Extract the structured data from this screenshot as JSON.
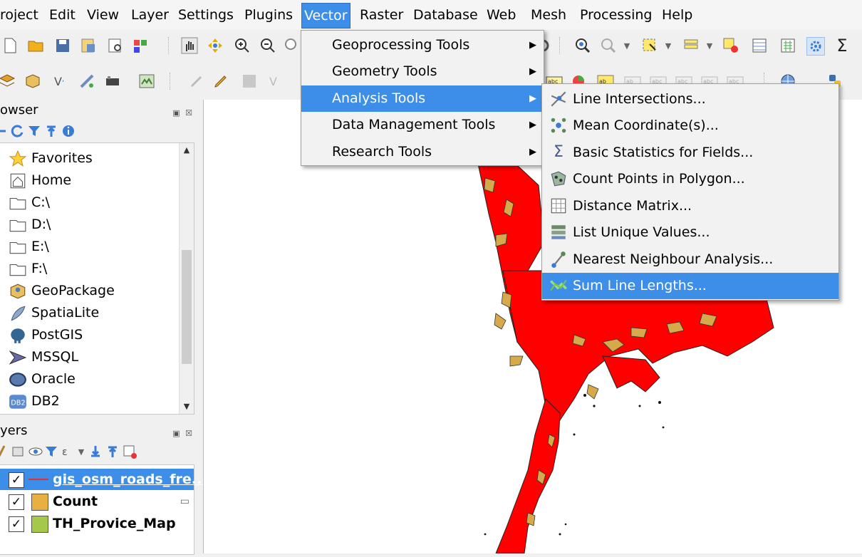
{
  "menubar": {
    "items": [
      "roject",
      "Edit",
      "View",
      "Layer",
      "Settings",
      "Plugins",
      "Vector",
      "Raster",
      "Database",
      "Web",
      "Mesh",
      "Processing",
      "Help"
    ],
    "active": "Vector"
  },
  "browser": {
    "title": "owser",
    "items": [
      "Favorites",
      "Home",
      "C:\\",
      "D:\\",
      "E:\\",
      "F:\\",
      "GeoPackage",
      "SpatiaLite",
      "PostGIS",
      "MSSQL",
      "Oracle",
      "DB2"
    ]
  },
  "layers": {
    "title": "yers",
    "items": [
      {
        "name": "gis_osm_roads_fre...",
        "checked": true,
        "swatch": "#e03030"
      },
      {
        "name": "Count",
        "checked": true,
        "swatch": "#e7b040"
      },
      {
        "name": "TH_Provice_Map",
        "checked": true,
        "swatch": "#a6c84a"
      }
    ]
  },
  "vector_menu": {
    "items": [
      "Geoprocessing Tools",
      "Geometry Tools",
      "Analysis Tools",
      "Data Management Tools",
      "Research Tools"
    ],
    "highlighted": "Analysis Tools"
  },
  "analysis_submenu": {
    "items": [
      {
        "label": "Line Intersections...",
        "icon": "line-intersections-icon"
      },
      {
        "label": "Mean Coordinate(s)...",
        "icon": "mean-coordinate-icon"
      },
      {
        "label": "Basic Statistics for Fields...",
        "icon": "sigma-icon"
      },
      {
        "label": "Count Points in Polygon...",
        "icon": "count-points-icon"
      },
      {
        "label": "Distance Matrix...",
        "icon": "distance-matrix-icon"
      },
      {
        "label": "List Unique Values...",
        "icon": "list-unique-icon"
      },
      {
        "label": "Nearest Neighbour Analysis...",
        "icon": "nearest-neighbour-icon"
      },
      {
        "label": "Sum Line Lengths...",
        "icon": "sum-line-lengths-icon"
      }
    ],
    "highlighted": "Sum Line Lengths..."
  },
  "colors": {
    "highlight": "#3d8ee8",
    "map_fill": "#ff0000",
    "map_land": "#d6a94a"
  }
}
